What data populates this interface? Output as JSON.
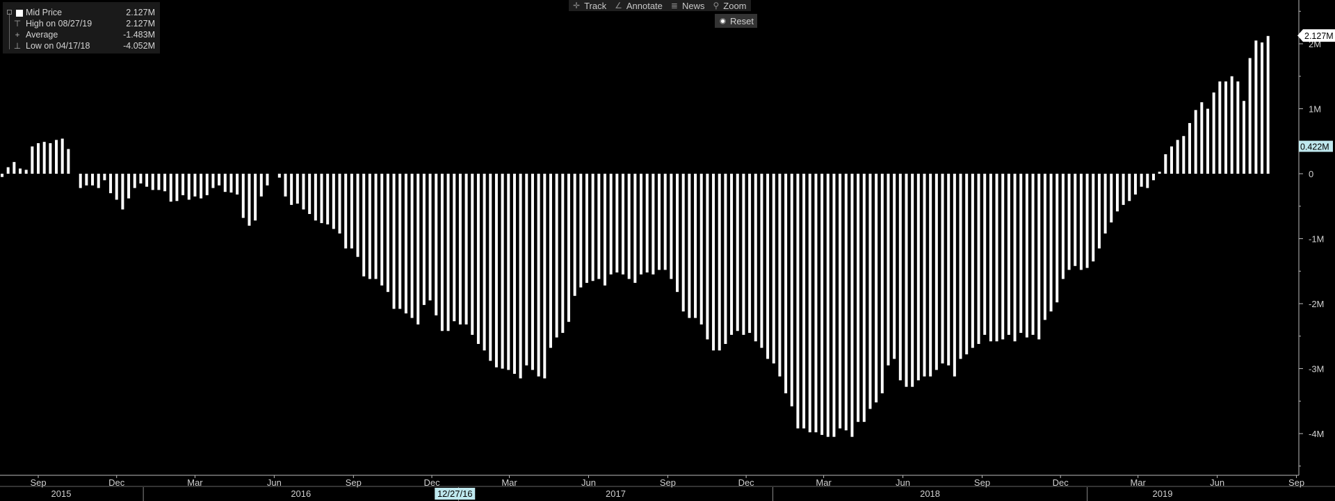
{
  "toolbar": {
    "items": [
      {
        "icon": "crosshair-icon",
        "glyph": "✛",
        "label": "Track"
      },
      {
        "icon": "pencil-icon",
        "glyph": "∠",
        "label": "Annotate"
      },
      {
        "icon": "news-icon",
        "glyph": "≣",
        "label": "News"
      },
      {
        "icon": "magnifier-icon",
        "glyph": "⚲",
        "label": "Zoom"
      }
    ],
    "reset_label": "Reset"
  },
  "legend": {
    "series_name": "Mid Price",
    "series_value": "2.127M",
    "high_label": "High on 08/27/19",
    "high_value": "2.127M",
    "average_label": "Average",
    "average_value": "-1.483M",
    "low_label": "Low on 04/17/18",
    "low_value": "-4.052M"
  },
  "colors": {
    "background": "#000000",
    "bars": "#ffffff",
    "axis": "#cccccc",
    "highlight_label_bg": "#bfe8ee"
  },
  "chart_data": {
    "type": "bar",
    "series": [
      {
        "name": "Mid Price",
        "start": "2015-07-21",
        "interval_days": 7
      }
    ],
    "values": [
      -0.05,
      0.1,
      0.18,
      0.08,
      0.06,
      0.42,
      0.47,
      0.49,
      0.47,
      0.52,
      0.54,
      0.38,
      0,
      -0.22,
      -0.18,
      -0.18,
      -0.22,
      -0.1,
      -0.3,
      -0.4,
      -0.55,
      -0.38,
      -0.22,
      -0.15,
      -0.2,
      -0.25,
      -0.25,
      -0.27,
      -0.43,
      -0.42,
      -0.33,
      -0.4,
      -0.35,
      -0.38,
      -0.33,
      -0.22,
      -0.18,
      -0.28,
      -0.29,
      -0.32,
      -0.68,
      -0.8,
      -0.72,
      -0.35,
      -0.18,
      0,
      -0.06,
      -0.35,
      -0.48,
      -0.46,
      -0.55,
      -0.62,
      -0.72,
      -0.76,
      -0.78,
      -0.85,
      -0.92,
      -1.15,
      -1.15,
      -1.28,
      -1.58,
      -1.62,
      -1.62,
      -1.72,
      -1.82,
      -2.08,
      -2.08,
      -2.15,
      -2.22,
      -2.32,
      -2.02,
      -1.95,
      -2.18,
      -2.42,
      -2.42,
      -2.27,
      -2.32,
      -2.32,
      -2.48,
      -2.62,
      -2.72,
      -2.88,
      -2.98,
      -3.0,
      -3.02,
      -3.08,
      -3.15,
      -2.95,
      -3.02,
      -3.12,
      -3.15,
      -2.68,
      -2.52,
      -2.45,
      -2.28,
      -1.88,
      -1.75,
      -1.68,
      -1.65,
      -1.62,
      -1.72,
      -1.55,
      -1.52,
      -1.55,
      -1.62,
      -1.68,
      -1.55,
      -1.52,
      -1.55,
      -1.48,
      -1.48,
      -1.62,
      -1.82,
      -2.12,
      -2.22,
      -2.22,
      -2.32,
      -2.55,
      -2.72,
      -2.72,
      -2.62,
      -2.48,
      -2.42,
      -2.48,
      -2.45,
      -2.58,
      -2.68,
      -2.85,
      -2.92,
      -3.12,
      -3.38,
      -3.58,
      -3.92,
      -3.92,
      -3.98,
      -3.98,
      -4.02,
      -4.05,
      -4.05,
      -3.92,
      -3.95,
      -4.05,
      -3.82,
      -3.82,
      -3.62,
      -3.52,
      -3.38,
      -2.95,
      -2.85,
      -3.18,
      -3.28,
      -3.28,
      -3.18,
      -3.12,
      -3.12,
      -3.02,
      -2.92,
      -2.95,
      -3.12,
      -2.85,
      -2.78,
      -2.68,
      -2.62,
      -2.48,
      -2.58,
      -2.58,
      -2.55,
      -2.48,
      -2.58,
      -2.45,
      -2.52,
      -2.48,
      -2.55,
      -2.25,
      -2.12,
      -1.98,
      -1.62,
      -1.48,
      -1.42,
      -1.48,
      -1.45,
      -1.35,
      -1.15,
      -0.92,
      -0.75,
      -0.58,
      -0.48,
      -0.42,
      -0.32,
      -0.2,
      -0.22,
      -0.1,
      0.03,
      0.3,
      0.42,
      0.52,
      0.58,
      0.78,
      0.98,
      1.1,
      1.0,
      1.25,
      1.42,
      1.42,
      1.5,
      1.42,
      1.12,
      1.78,
      2.05,
      2.02,
      2.12
    ],
    "ylim": [
      -4.6,
      2.65
    ],
    "y_ticks": [
      {
        "value": 2,
        "label": "2M"
      },
      {
        "value": 1,
        "label": "1M"
      },
      {
        "value": 0,
        "label": "0"
      },
      {
        "value": -1,
        "label": "-1M"
      },
      {
        "value": -2,
        "label": "-2M"
      },
      {
        "value": -3,
        "label": "-3M"
      },
      {
        "value": -4,
        "label": "-4M"
      }
    ],
    "x_month_ticks": [
      {
        "date": "2015-09-01",
        "label": "Sep"
      },
      {
        "date": "2015-12-01",
        "label": "Dec"
      },
      {
        "date": "2016-03-01",
        "label": "Mar"
      },
      {
        "date": "2016-06-01",
        "label": "Jun"
      },
      {
        "date": "2016-09-01",
        "label": "Sep"
      },
      {
        "date": "2016-12-01",
        "label": "Dec"
      },
      {
        "date": "2017-03-01",
        "label": "Mar"
      },
      {
        "date": "2017-06-01",
        "label": "Jun"
      },
      {
        "date": "2017-09-01",
        "label": "Sep"
      },
      {
        "date": "2017-12-01",
        "label": "Dec"
      },
      {
        "date": "2018-03-01",
        "label": "Mar"
      },
      {
        "date": "2018-06-01",
        "label": "Jun"
      },
      {
        "date": "2018-09-01",
        "label": "Sep"
      },
      {
        "date": "2018-12-01",
        "label": "Dec"
      },
      {
        "date": "2019-03-01",
        "label": "Mar"
      },
      {
        "date": "2019-06-01",
        "label": "Jun"
      },
      {
        "date": "2019-09-01",
        "label": "Sep"
      }
    ],
    "x_year_labels": [
      "2015",
      "2016",
      "2017",
      "2018",
      "2019"
    ],
    "x_highlight_label": "12/27/16",
    "last_value_label": "2.127M",
    "secondary_value_label": "0.422M",
    "grid": false,
    "legend_position": "top-left"
  }
}
